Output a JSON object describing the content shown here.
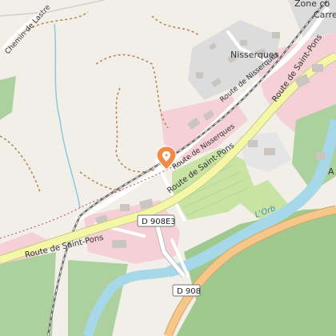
{
  "map": {
    "colors": {
      "background": "#f2efe9",
      "forest": "#9fc98e",
      "orchard": "#c8e3a4",
      "residential": "#e0dfdf",
      "industrial": "#f5d0d6",
      "water": "#a6d8ea",
      "primary_road": "#f4f7a8",
      "secondary_road": "#ffffff",
      "rail": "#707070",
      "marker": "#f28a48"
    },
    "road_labels": {
      "route_saint_pons_west": "Route de Saint-Pons",
      "route_saint_pons_center": "Route de Saint-Pons",
      "route_saint_pons_east": "Route de Saint-Pons",
      "route_nisserques_south": "Route de Nisserques",
      "route_nisserques_north": "Route de Nisserques",
      "chemin_lastre": "Chemin de Lastre"
    },
    "places": {
      "nisserques": "Nisserques",
      "zone_commerciale": "Zone co",
      "carre": "Carre",
      "river": "L'Orb",
      "edge_a": "A"
    },
    "shields": {
      "d908e3": "D 908E3",
      "d908": "D 908"
    },
    "marker": {
      "icon": "location-pin-icon"
    }
  }
}
